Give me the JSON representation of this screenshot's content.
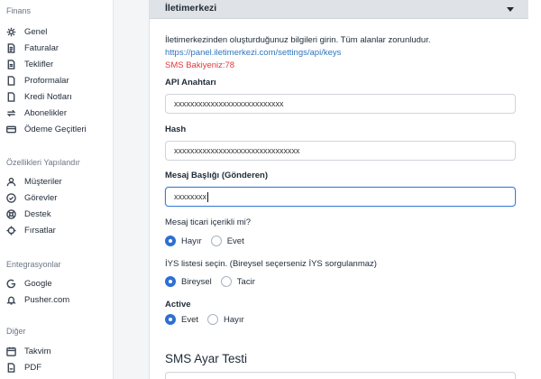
{
  "sidebar": {
    "sections": [
      {
        "title": "Finans",
        "items": [
          {
            "label": "Genel",
            "icon": "gear-icon"
          },
          {
            "label": "Faturalar",
            "icon": "document-icon"
          },
          {
            "label": "Teklifler",
            "icon": "file-icon"
          },
          {
            "label": "Proformalar",
            "icon": "file-outline-icon"
          },
          {
            "label": "Kredi Notları",
            "icon": "file-outline-icon"
          },
          {
            "label": "Abonelikler",
            "icon": "repeat-icon"
          },
          {
            "label": "Ödeme Geçitleri",
            "icon": "credit-card-icon"
          }
        ]
      },
      {
        "title": "Özellikleri Yapılandır",
        "items": [
          {
            "label": "Müşteriler",
            "icon": "user-icon"
          },
          {
            "label": "Görevler",
            "icon": "check-circle-icon"
          },
          {
            "label": "Destek",
            "icon": "lifebuoy-icon"
          },
          {
            "label": "Fırsatlar",
            "icon": "crosshair-icon"
          }
        ]
      },
      {
        "title": "Entegrasyonlar",
        "items": [
          {
            "label": "Google",
            "icon": "google-icon"
          },
          {
            "label": "Pusher.com",
            "icon": "bell-icon"
          }
        ]
      },
      {
        "title": "Diğer",
        "items": [
          {
            "label": "Takvim",
            "icon": "calendar-icon"
          },
          {
            "label": "PDF",
            "icon": "pdf-icon"
          }
        ]
      }
    ]
  },
  "panel": {
    "title": "İletimerkezi",
    "intro": "İletimerkezinden oluşturduğunuz bilgileri girin. Tüm alanlar zorunludur.",
    "link": "https://panel.iletimerkezi.com/settings/api/keys",
    "balance": "SMS Bakiyeniz:78",
    "api_key_label": "API Anahtarı",
    "api_key_value": "xxxxxxxxxxxxxxxxxxxxxxxxxxx",
    "hash_label": "Hash",
    "hash_value": "xxxxxxxxxxxxxxxxxxxxxxxxxxxxxxx",
    "sender_label": "Mesaj Başlığı (Gönderen)",
    "sender_value": "xxxxxxxx",
    "commercial_question": "Mesaj ticari içerikli mi?",
    "commercial_options": [
      {
        "label": "Hayır",
        "selected": true
      },
      {
        "label": "Evet",
        "selected": false
      }
    ],
    "iys_question": "İYS listesi seçin. (Bireysel seçerseniz İYS sorgulanmaz)",
    "iys_options": [
      {
        "label": "Bireysel",
        "selected": true
      },
      {
        "label": "Tacir",
        "selected": false
      }
    ],
    "active_label": "Active",
    "active_options": [
      {
        "label": "Evet",
        "selected": true
      },
      {
        "label": "Hayır",
        "selected": false
      }
    ],
    "test_heading": "SMS Ayar Testi"
  },
  "colors": {
    "accent": "#2f6fd2",
    "link": "#2f74c0",
    "warning": "#e0383e",
    "focus": "#3b7fd6"
  }
}
